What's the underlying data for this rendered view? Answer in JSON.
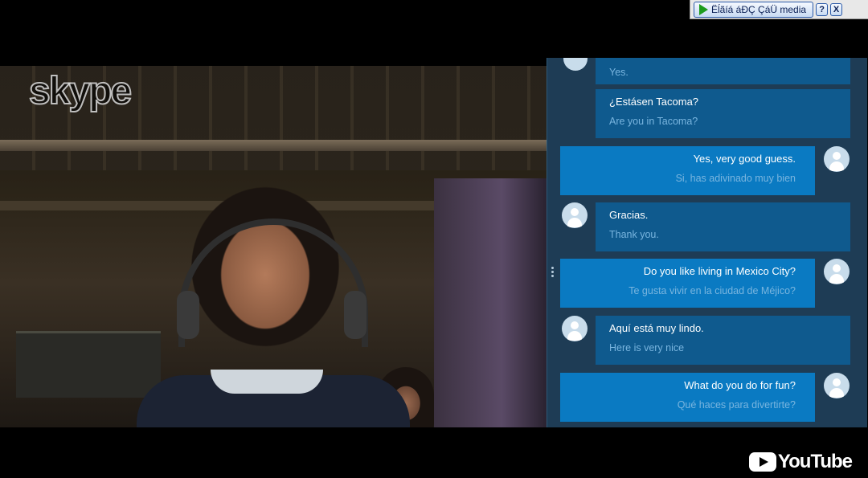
{
  "toolbar": {
    "media_label": "Ëĺãíá áĐÇ ÇáÜ media",
    "help_label": "?",
    "close_label": "X",
    "play_icon": "play-icon"
  },
  "video": {
    "watermark": "skype"
  },
  "chat": {
    "messages": [
      {
        "direction": "in",
        "line1": "",
        "line2": "Yes."
      },
      {
        "direction": "in",
        "line1": "¿Estásen Tacoma?",
        "line2": "Are you in Tacoma?"
      },
      {
        "direction": "out",
        "line1": "Yes, very good guess.",
        "line2": "Si, has adivinado muy bien"
      },
      {
        "direction": "in",
        "line1": "Gracias.",
        "line2": "Thank you."
      },
      {
        "direction": "out",
        "line1": "Do you like living in Mexico City?",
        "line2": "Te gusta vivir en la ciudad de Méjico?"
      },
      {
        "direction": "in",
        "line1": "Aquí está muy lindo.",
        "line2": "Here is very nice"
      },
      {
        "direction": "out",
        "line1": "What do you do for fun?",
        "line2": "Qué haces para divertirte?"
      }
    ]
  },
  "youtube": {
    "label": "YouTube"
  },
  "colors": {
    "panel_bg": "#1e3c55",
    "bubble_in": "#0f5a8e",
    "bubble_out": "#0a7ac2",
    "translation_text": "#79b5df"
  }
}
